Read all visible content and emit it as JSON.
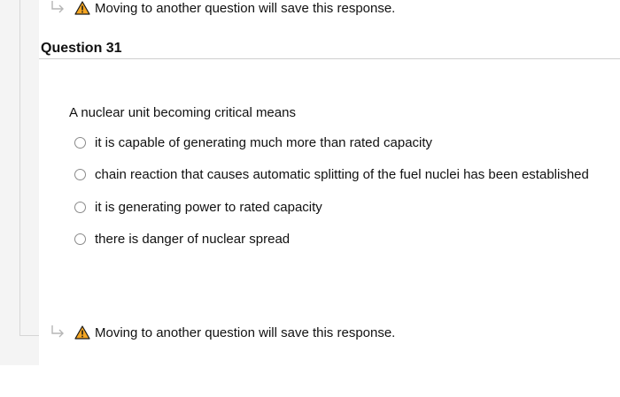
{
  "notices": {
    "top": "Moving to another question will save this response.",
    "bottom": "Moving to another question will save this response."
  },
  "question": {
    "title": "Question 31",
    "prompt": "A nuclear unit becoming critical means",
    "options": [
      "it is capable of generating much more than rated capacity",
      "chain reaction that causes automatic splitting of the fuel nuclei has been established",
      "it is generating power to rated capacity",
      "there is danger of nuclear spread"
    ]
  },
  "icons": {
    "arrow": "return-arrow-icon",
    "warning": "warning-icon"
  },
  "colors": {
    "warning_fill": "#f5a623",
    "warning_stroke": "#1a1a1a",
    "rule": "#cfcfcf",
    "panel": "#f4f4f4"
  }
}
